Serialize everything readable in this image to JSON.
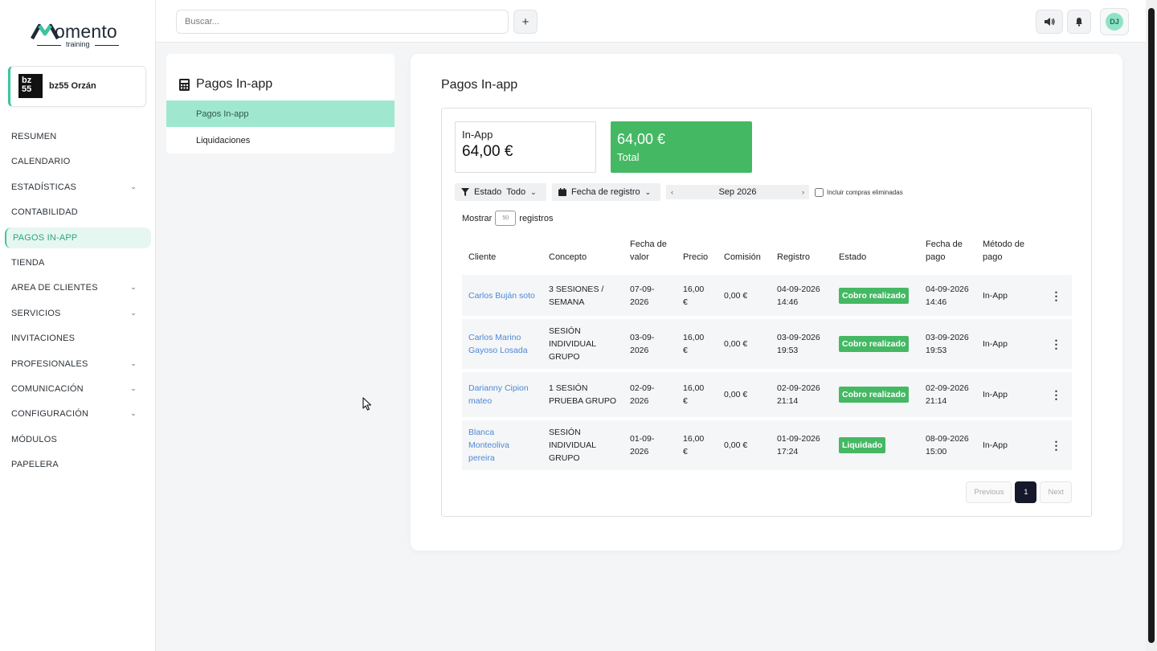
{
  "brand": {
    "name": "omento",
    "sub": "training",
    "accent": "#39c6a0"
  },
  "org": {
    "logo_text": "bz\n55",
    "name": "bz55 Orzán"
  },
  "sidebar": {
    "items": [
      {
        "label": "RESUMEN"
      },
      {
        "label": "CALENDARIO"
      },
      {
        "label": "ESTADÍSTICAS",
        "expandable": true
      },
      {
        "label": "CONTABILIDAD"
      },
      {
        "label": "PAGOS IN-APP",
        "active": true
      },
      {
        "label": "TIENDA"
      },
      {
        "label": "AREA DE CLIENTES",
        "expandable": true
      },
      {
        "label": "SERVICIOS",
        "expandable": true
      },
      {
        "label": "INVITACIONES"
      },
      {
        "label": "PROFESIONALES",
        "expandable": true
      },
      {
        "label": "COMUNICACIÓN",
        "expandable": true
      },
      {
        "label": "CONFIGURACIÓN",
        "expandable": true
      },
      {
        "label": "MÓDULOS"
      },
      {
        "label": "PAPELERA"
      }
    ]
  },
  "topbar": {
    "search_placeholder": "Buscar...",
    "add_icon": "plus-icon",
    "sound_icon": "speaker-icon",
    "bell_icon": "bell-icon",
    "avatar_initials": "DJ"
  },
  "submenu": {
    "title": "Pagos In-app",
    "items": [
      {
        "label": "Pagos In-app",
        "active": true
      },
      {
        "label": "Liquidaciones"
      }
    ]
  },
  "main": {
    "title": "Pagos In-app",
    "stats": {
      "inapp_label": "In-App",
      "inapp_value": "64,00 €",
      "total_value": "64,00 €",
      "total_label": "Total"
    },
    "filters": {
      "estado_label": "Estado",
      "estado_value": "Todo",
      "fecha_label": "Fecha de registro",
      "month": "Sep 2026",
      "include_deleted": "Incluir compras eliminadas"
    },
    "show": {
      "before": "Mostrar",
      "value": "50",
      "after": "registros"
    },
    "columns": [
      "Cliente",
      "Concepto",
      "Fecha de valor",
      "Precio",
      "Comisión",
      "Registro",
      "Estado",
      "Fecha de pago",
      "Método de pago"
    ],
    "rows": [
      {
        "cliente": "Carlos Buján soto",
        "concepto": "3 SESIONES / SEMANA",
        "fecha_valor": "07-09-2026",
        "precio": "16,00 €",
        "comision": "0,00 €",
        "registro": "04-09-2026 14:46",
        "estado": "Cobro realizado",
        "fecha_pago": "04-09-2026 14:46",
        "metodo": "In-App"
      },
      {
        "cliente": "Carlos Marino Gayoso Losada",
        "concepto": "SESIÓN INDIVIDUAL GRUPO",
        "fecha_valor": "03-09-2026",
        "precio": "16,00 €",
        "comision": "0,00 €",
        "registro": "03-09-2026 19:53",
        "estado": "Cobro realizado",
        "fecha_pago": "03-09-2026 19:53",
        "metodo": "In-App"
      },
      {
        "cliente": "Darianny Cipion mateo",
        "concepto": "1 SESIÓN PRUEBA GRUPO",
        "fecha_valor": "02-09-2026",
        "precio": "16,00 €",
        "comision": "0,00 €",
        "registro": "02-09-2026 21:14",
        "estado": "Cobro realizado",
        "fecha_pago": "02-09-2026 21:14",
        "metodo": "In-App"
      },
      {
        "cliente": "Blanca Monteoliva pereira",
        "concepto": "SESIÓN INDIVIDUAL GRUPO",
        "fecha_valor": "01-09-2026",
        "precio": "16,00 €",
        "comision": "0,00 €",
        "registro": "01-09-2026 17:24",
        "estado": "Liquidado",
        "fecha_pago": "08-09-2026 15:00",
        "metodo": "In-App"
      }
    ],
    "pagination": {
      "previous": "Previous",
      "current": "1",
      "next": "Next"
    }
  }
}
